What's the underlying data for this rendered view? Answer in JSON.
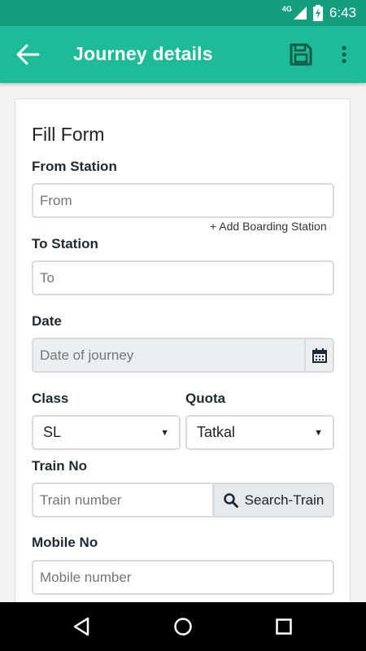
{
  "status_bar": {
    "network": "4G",
    "time": "6:43"
  },
  "app_bar": {
    "title": "Journey details",
    "back_icon": "arrow-back-icon",
    "save_icon": "floppy-disk-icon",
    "more_icon": "more-vert-icon"
  },
  "form": {
    "title": "Fill Form",
    "from_station": {
      "label": "From Station",
      "placeholder": "From",
      "add_boarding": "+ Add Boarding Station"
    },
    "to_station": {
      "label": "To Station",
      "placeholder": "To"
    },
    "date": {
      "label": "Date",
      "placeholder": "Date of journey",
      "icon": "calendar-icon"
    },
    "class": {
      "label": "Class",
      "selected": "SL"
    },
    "quota": {
      "label": "Quota",
      "selected": "Tatkal"
    },
    "train_no": {
      "label": "Train No",
      "placeholder": "Train number",
      "search_button": "Search-Train",
      "search_icon": "search-icon"
    },
    "mobile_no": {
      "label": "Mobile No",
      "placeholder": "Mobile number"
    }
  },
  "nav_bar": {
    "back": "nav-back-icon",
    "home": "nav-home-icon",
    "recents": "nav-recents-icon"
  },
  "colors": {
    "app_bar": "#1dbb98",
    "status_bar": "#149e7f",
    "input_border": "#d6dbe0"
  }
}
